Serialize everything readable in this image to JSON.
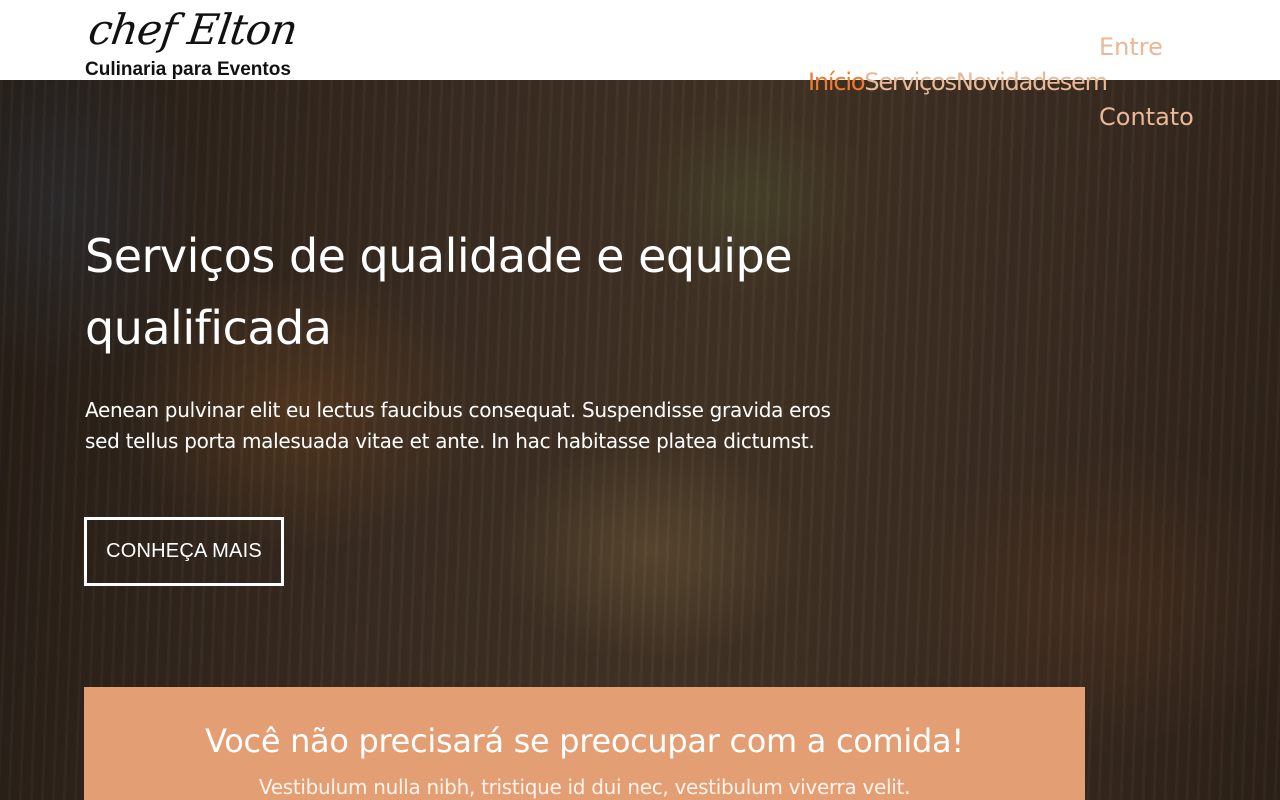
{
  "brand": {
    "logo_text": "chef Elton",
    "tagline": "Culinaria para Eventos"
  },
  "nav": {
    "items": [
      {
        "label_parts": [
          "Início"
        ],
        "active": true
      },
      {
        "label_parts": [
          "Serviços"
        ],
        "active": false
      },
      {
        "label_parts": [
          "Novidades"
        ],
        "active": false
      },
      {
        "label_parts": [
          "Entre",
          "em",
          "Contato"
        ],
        "active": false
      }
    ],
    "colors": {
      "active": "#f07a30",
      "inactive": "#e8b897"
    }
  },
  "hero": {
    "title": "Serviços de qualidade e equipe qualificada",
    "text": "Aenean pulvinar elit eu lectus faucibus consequat. Suspendisse gravida eros sed tellus porta malesuada vitae et ante. In hac habitasse platea dictumst.",
    "button_label": "CONHEÇA MAIS"
  },
  "feature": {
    "title": "Você não precisará se preocupar com a comida!",
    "text": "Vestibulum nulla nibh, tristique id dui nec, vestibulum viverra velit.",
    "background_color": "#e39e74"
  }
}
